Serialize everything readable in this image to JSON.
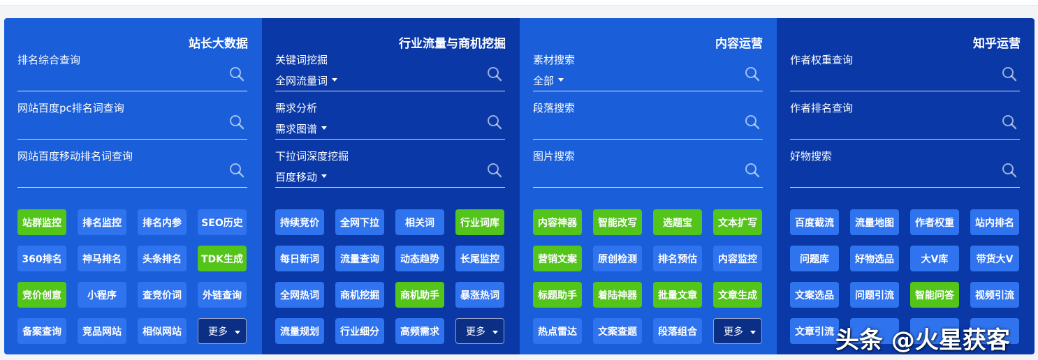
{
  "panels": [
    {
      "title": "站长大数据",
      "fields": [
        {
          "label": "排名综合查询",
          "dropdown": ""
        },
        {
          "label": "网站百度pc排名词查询",
          "dropdown": ""
        },
        {
          "label": "网站百度移动排名词查询",
          "dropdown": ""
        }
      ],
      "buttons": [
        {
          "label": "站群监控",
          "style": "green"
        },
        {
          "label": "排名监控",
          "style": "blue"
        },
        {
          "label": "排名内参",
          "style": "blue"
        },
        {
          "label": "SEO历史",
          "style": "blue"
        },
        {
          "label": "360排名",
          "style": "blue"
        },
        {
          "label": "神马排名",
          "style": "blue"
        },
        {
          "label": "头条排名",
          "style": "blue"
        },
        {
          "label": "TDK生成",
          "style": "green"
        },
        {
          "label": "竞价创意",
          "style": "green"
        },
        {
          "label": "小程序",
          "style": "blue"
        },
        {
          "label": "查竞价词",
          "style": "blue"
        },
        {
          "label": "外链查询",
          "style": "blue"
        },
        {
          "label": "备案查询",
          "style": "blue"
        },
        {
          "label": "竞品网站",
          "style": "blue"
        },
        {
          "label": "相似网站",
          "style": "blue"
        },
        {
          "label": "更多",
          "style": "more"
        }
      ]
    },
    {
      "title": "行业流量与商机挖掘",
      "fields": [
        {
          "label": "关键词挖掘",
          "dropdown": "全网流量词"
        },
        {
          "label": "需求分析",
          "dropdown": "需求图谱"
        },
        {
          "label": "下拉词深度挖掘",
          "dropdown": "百度移动"
        }
      ],
      "buttons": [
        {
          "label": "持续竞价",
          "style": "blue"
        },
        {
          "label": "全网下拉",
          "style": "blue"
        },
        {
          "label": "相关词",
          "style": "blue"
        },
        {
          "label": "行业词库",
          "style": "green"
        },
        {
          "label": "每日新词",
          "style": "blue"
        },
        {
          "label": "流量查询",
          "style": "blue"
        },
        {
          "label": "动态趋势",
          "style": "blue"
        },
        {
          "label": "长尾监控",
          "style": "blue"
        },
        {
          "label": "全网热词",
          "style": "blue"
        },
        {
          "label": "商机挖掘",
          "style": "blue"
        },
        {
          "label": "商机助手",
          "style": "green"
        },
        {
          "label": "暴涨热词",
          "style": "blue"
        },
        {
          "label": "流量规划",
          "style": "blue"
        },
        {
          "label": "行业细分",
          "style": "blue"
        },
        {
          "label": "高频需求",
          "style": "blue"
        },
        {
          "label": "更多",
          "style": "more"
        }
      ]
    },
    {
      "title": "内容运营",
      "fields": [
        {
          "label": "素材搜索",
          "dropdown": "全部"
        },
        {
          "label": "段落搜索",
          "dropdown": ""
        },
        {
          "label": "图片搜索",
          "dropdown": ""
        }
      ],
      "buttons": [
        {
          "label": "内容神器",
          "style": "green"
        },
        {
          "label": "智能改写",
          "style": "green"
        },
        {
          "label": "选题宝",
          "style": "green"
        },
        {
          "label": "文本扩写",
          "style": "green"
        },
        {
          "label": "营销文案",
          "style": "green"
        },
        {
          "label": "原创检测",
          "style": "blue"
        },
        {
          "label": "排名预估",
          "style": "blue"
        },
        {
          "label": "内容监控",
          "style": "blue"
        },
        {
          "label": "标题助手",
          "style": "green"
        },
        {
          "label": "着陆神器",
          "style": "green"
        },
        {
          "label": "批量文章",
          "style": "green"
        },
        {
          "label": "文章生成",
          "style": "green"
        },
        {
          "label": "热点雷达",
          "style": "blue"
        },
        {
          "label": "文案查题",
          "style": "blue"
        },
        {
          "label": "段落组合",
          "style": "blue"
        },
        {
          "label": "更多",
          "style": "more"
        }
      ]
    },
    {
      "title": "知乎运营",
      "fields": [
        {
          "label": "作者权重查询",
          "dropdown": ""
        },
        {
          "label": "作者排名查询",
          "dropdown": ""
        },
        {
          "label": "好物搜索",
          "dropdown": ""
        }
      ],
      "buttons": [
        {
          "label": "百度截流",
          "style": "blue"
        },
        {
          "label": "流量地图",
          "style": "blue"
        },
        {
          "label": "作者权重",
          "style": "blue"
        },
        {
          "label": "站内排名",
          "style": "blue"
        },
        {
          "label": "问题库",
          "style": "blue"
        },
        {
          "label": "好物选品",
          "style": "blue"
        },
        {
          "label": "大V库",
          "style": "blue"
        },
        {
          "label": "带货大V",
          "style": "blue"
        },
        {
          "label": "文案选品",
          "style": "blue"
        },
        {
          "label": "问题引流",
          "style": "blue"
        },
        {
          "label": "智能问答",
          "style": "green"
        },
        {
          "label": "视频引流",
          "style": "blue"
        },
        {
          "label": "文章引流",
          "style": "blue"
        },
        {
          "label": "",
          "style": "blue"
        },
        {
          "label": "",
          "style": "blue"
        },
        {
          "label": "",
          "style": "blue"
        }
      ]
    }
  ],
  "watermark": "头条 @火星获客",
  "colors": {
    "panel_light": "#1a5fd9",
    "panel_dark": "#0a39a7",
    "button_blue": "#2f73ef",
    "button_green": "#52c41a",
    "button_more": "#0c2f86"
  }
}
